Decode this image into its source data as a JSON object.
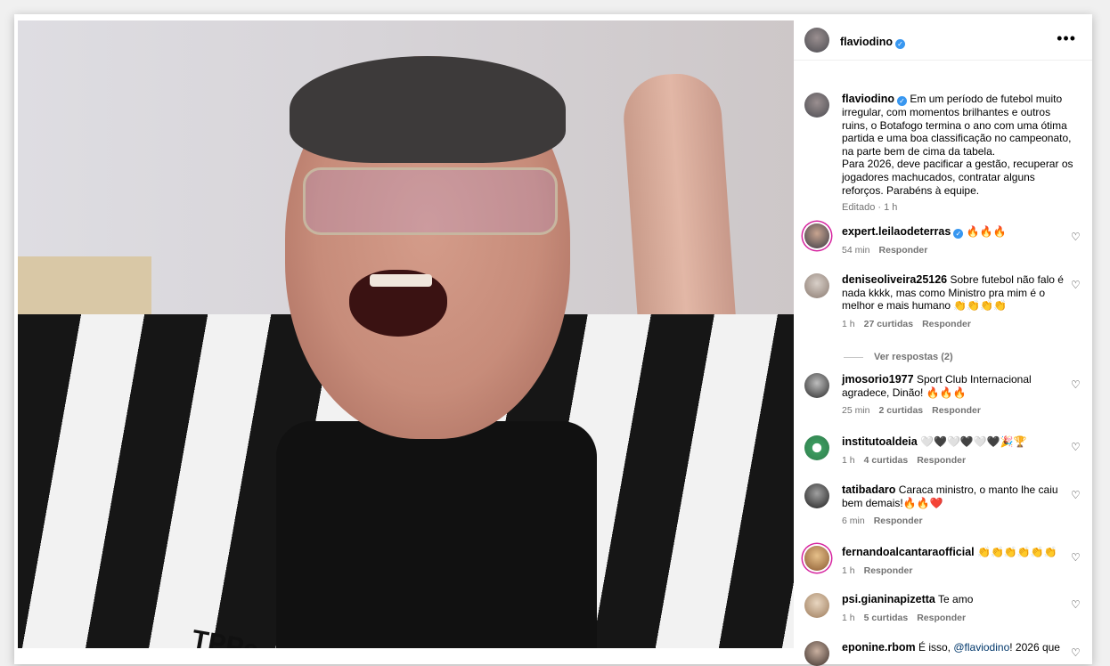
{
  "post": {
    "username": "flaviodino",
    "caption_lines": [
      "Em um período de futebol muito",
      "irregular, com momentos brilhantes e outros",
      "ruins, o Botafogo termina o ano com uma ótima",
      "partida e uma boa classificação no campeonato,",
      "na parte bem de cima da tabela.",
      "Para 2026, deve pacificar a gestão, recuperar os",
      "jogadores machucados, contratar alguns",
      "reforços. Parabéns à equipe."
    ],
    "edited": "Editado",
    "time": "1 h",
    "photo_text": "TPPe"
  },
  "comments": [
    {
      "user": "expert.leilaodeterras",
      "verified": true,
      "text": "🔥🔥🔥",
      "time": "54 min",
      "likes": "",
      "reply": "Responder"
    },
    {
      "user": "deniseoliveira25126",
      "verified": false,
      "text": "Sobre futebol não falo é nada kkkk, mas como Ministro pra mim é o melhor e mais humano 👏👏👏👏",
      "time": "1 h",
      "likes": "27 curtidas",
      "reply": "Responder"
    },
    {
      "user": "jmosorio1977",
      "verified": false,
      "text": "Sport Club Internacional agradece, Dinão! 🔥🔥🔥",
      "time": "25 min",
      "likes": "2 curtidas",
      "reply": "Responder"
    },
    {
      "user": "institutoaldeia",
      "verified": false,
      "text": "🤍🖤🤍🖤🤍🖤🎉🏆",
      "time": "1 h",
      "likes": "4 curtidas",
      "reply": "Responder"
    },
    {
      "user": "tatibadaro",
      "verified": false,
      "text": "Caraca ministro, o manto lhe caiu bem demais!🔥🔥❤️",
      "time": "6 min",
      "likes": "",
      "reply": "Responder"
    },
    {
      "user": "fernandoalcantaraofficial",
      "verified": false,
      "text": "👏👏👏👏👏👏",
      "time": "1 h",
      "likes": "",
      "reply": "Responder"
    },
    {
      "user": "psi.gianinapizetta",
      "verified": false,
      "text": "Te amo",
      "time": "1 h",
      "likes": "5 curtidas",
      "reply": "Responder"
    },
    {
      "user": "eponine.rbom",
      "verified": false,
      "text_before": "É isso,",
      "mention": "@flaviodino",
      "text_after": "! 2026 que"
    }
  ],
  "view_replies": "Ver respostas (2)",
  "colors": {
    "verified": "#3897f0",
    "muted": "#737373",
    "mention": "#00376b"
  }
}
